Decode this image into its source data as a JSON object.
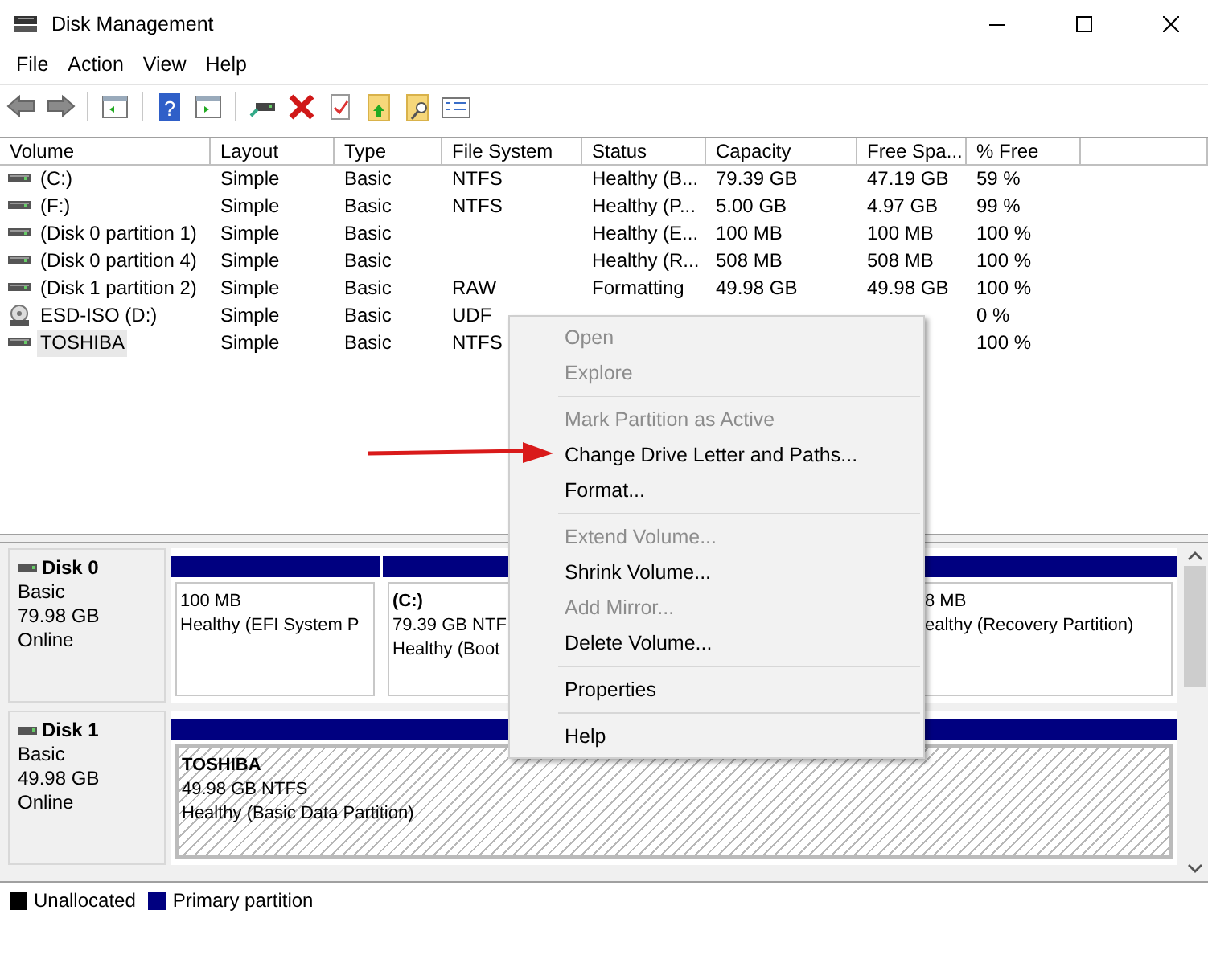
{
  "window": {
    "title": "Disk Management"
  },
  "menu": [
    "File",
    "Action",
    "View",
    "Help"
  ],
  "toolbar": {
    "help_icon": "?"
  },
  "table": {
    "columns": [
      "Volume",
      "Layout",
      "Type",
      "File System",
      "Status",
      "Capacity",
      "Free Spa...",
      "% Free"
    ],
    "rows": [
      {
        "kind": "drive",
        "selected": false,
        "cells": [
          "(C:)",
          "Simple",
          "Basic",
          "NTFS",
          "Healthy (B...",
          "79.39 GB",
          "47.19 GB",
          "59 %"
        ]
      },
      {
        "kind": "drive",
        "selected": false,
        "cells": [
          "(F:)",
          "Simple",
          "Basic",
          "NTFS",
          "Healthy (P...",
          "5.00 GB",
          "4.97 GB",
          "99 %"
        ]
      },
      {
        "kind": "drive",
        "selected": false,
        "cells": [
          "(Disk 0 partition 1)",
          "Simple",
          "Basic",
          "",
          "Healthy (E...",
          "100 MB",
          "100 MB",
          "100 %"
        ]
      },
      {
        "kind": "drive",
        "selected": false,
        "cells": [
          "(Disk 0 partition 4)",
          "Simple",
          "Basic",
          "",
          "Healthy (R...",
          "508 MB",
          "508 MB",
          "100 %"
        ]
      },
      {
        "kind": "drive",
        "selected": false,
        "cells": [
          "(Disk 1 partition 2)",
          "Simple",
          "Basic",
          "RAW",
          "Formatting",
          "49.98 GB",
          "49.98 GB",
          "100 %"
        ]
      },
      {
        "kind": "disc",
        "selected": false,
        "cells": [
          "ESD-ISO (D:)",
          "Simple",
          "Basic",
          "UDF",
          "",
          "",
          "",
          "0 %"
        ]
      },
      {
        "kind": "drive",
        "selected": true,
        "cells": [
          "TOSHIBA",
          "Simple",
          "Basic",
          "NTFS",
          "",
          "",
          "",
          "100 %"
        ]
      }
    ]
  },
  "disks": [
    {
      "name": "Disk 0",
      "type": "Basic",
      "size": "79.98 GB",
      "status": "Online",
      "partitions": [
        {
          "size": "100 MB",
          "status": "Healthy (EFI System P"
        },
        {
          "label": "(C:)",
          "size": "79.39 GB NTF",
          "status": "Healthy (Boot"
        },
        {
          "size": "8 MB",
          "status": "ealthy (Recovery Partition)"
        }
      ]
    },
    {
      "name": "Disk 1",
      "type": "Basic",
      "size": "49.98 GB",
      "status": "Online",
      "partitions": [
        {
          "label": "TOSHIBA",
          "size": "49.98 GB NTFS",
          "status": "Healthy (Basic Data Partition)"
        }
      ]
    }
  ],
  "legend": [
    {
      "label": "Unallocated",
      "color": "#000000"
    },
    {
      "label": "Primary partition",
      "color": "#000080"
    }
  ],
  "context_menu": [
    [
      {
        "label": "Open",
        "disabled": true
      },
      {
        "label": "Explore",
        "disabled": true
      }
    ],
    [
      {
        "label": "Mark Partition as Active",
        "disabled": true
      },
      {
        "label": "Change Drive Letter and Paths...",
        "disabled": false
      },
      {
        "label": "Format...",
        "disabled": false
      }
    ],
    [
      {
        "label": "Extend Volume...",
        "disabled": true
      },
      {
        "label": "Shrink Volume...",
        "disabled": false
      },
      {
        "label": "Add Mirror...",
        "disabled": true
      },
      {
        "label": "Delete Volume...",
        "disabled": false
      }
    ],
    [
      {
        "label": "Properties",
        "disabled": false
      }
    ],
    [
      {
        "label": "Help",
        "disabled": false
      }
    ]
  ]
}
